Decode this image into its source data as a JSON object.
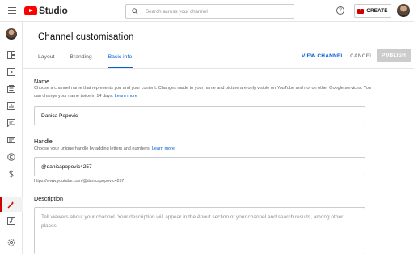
{
  "app": {
    "logo_text": "Studio",
    "search_placeholder": "Search across your channel",
    "help_glyph": "?",
    "create_label": "CREATE"
  },
  "sidebar": {
    "items": [
      {
        "icon": "dashboard-icon"
      },
      {
        "icon": "content-icon"
      },
      {
        "icon": "playlists-icon"
      },
      {
        "icon": "analytics-icon"
      },
      {
        "icon": "comments-icon"
      },
      {
        "icon": "subtitles-icon"
      },
      {
        "icon": "copyright-icon"
      },
      {
        "icon": "earn-icon"
      },
      {
        "icon": "customisation-icon",
        "active": true
      },
      {
        "icon": "audio-library-icon"
      },
      {
        "icon": "settings-icon"
      },
      {
        "icon": "feedback-icon"
      }
    ]
  },
  "page": {
    "title": "Channel customisation",
    "tabs": [
      {
        "label": "Layout",
        "active": false
      },
      {
        "label": "Branding",
        "active": false
      },
      {
        "label": "Basic info",
        "active": true
      }
    ],
    "view_channel_label": "VIEW CHANNEL",
    "cancel_label": "CANCEL",
    "publish_label": "PUBLISH"
  },
  "name_section": {
    "label": "Name",
    "help": "Choose a channel name that represents you and your content. Changes made to your name and picture are only visible on YouTube and not on other Google services. You can change your name twice in 14 days.",
    "learn_more": "Learn more",
    "value": "Danica Popovic"
  },
  "handle_section": {
    "label": "Handle",
    "help": "Choose your unique handle by adding letters and numbers.",
    "learn_more": "Learn more",
    "value": "@danicapopovic4257",
    "url": "https://www.youtube.com/@danicapopovic4257"
  },
  "description_section": {
    "label": "Description",
    "placeholder": "Tell viewers about your channel. Your description will appear in the About section of your channel and search results, among other places."
  },
  "colors": {
    "accent": "#065fd4",
    "brand_red": "#ff0000",
    "active_indicator": "#cc0000",
    "disabled_button": "#cccccc"
  }
}
